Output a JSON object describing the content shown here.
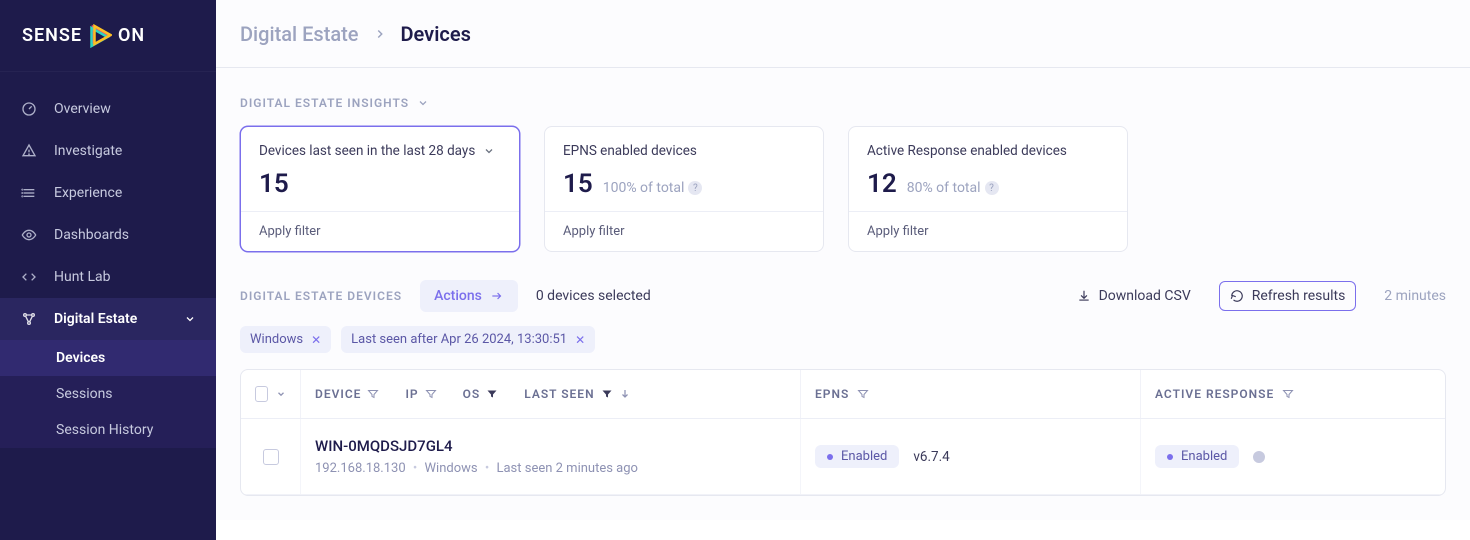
{
  "brand": {
    "text_left": "SENSE",
    "text_right": "ON"
  },
  "sidebar": {
    "items": [
      {
        "label": "Overview"
      },
      {
        "label": "Investigate"
      },
      {
        "label": "Experience"
      },
      {
        "label": "Dashboards"
      },
      {
        "label": "Hunt Lab"
      },
      {
        "label": "Digital Estate"
      }
    ],
    "sub": [
      {
        "label": "Devices"
      },
      {
        "label": "Sessions"
      },
      {
        "label": "Session History"
      }
    ]
  },
  "breadcrumb": {
    "parent": "Digital Estate",
    "current": "Devices"
  },
  "insights": {
    "heading": "DIGITAL ESTATE INSIGHTS",
    "cards": [
      {
        "title": "Devices last seen in the last 28 days",
        "value": "15",
        "sub": "",
        "footer": "Apply filter"
      },
      {
        "title": "EPNS enabled devices",
        "value": "15",
        "sub": "100% of total",
        "footer": "Apply filter"
      },
      {
        "title": "Active Response enabled devices",
        "value": "12",
        "sub": "80% of total",
        "footer": "Apply filter"
      }
    ]
  },
  "devices": {
    "heading": "DIGITAL ESTATE DEVICES",
    "actions_label": "Actions",
    "selected_text": "0 devices selected",
    "download_label": "Download CSV",
    "refresh_label": "Refresh results",
    "refreshed_ago": "2 minutes",
    "chips": [
      "Windows",
      "Last seen after Apr 26 2024, 13:30:51"
    ],
    "columns": {
      "device": "DEVICE",
      "ip": "IP",
      "os": "OS",
      "last_seen": "LAST SEEN",
      "epns": "EPNS",
      "active_response": "ACTIVE RESPONSE"
    },
    "rows": [
      {
        "name": "WIN-0MQDSJD7GL4",
        "ip": "192.168.18.130",
        "os": "Windows",
        "last_seen": "Last seen 2 minutes ago",
        "epns_status": "Enabled",
        "epns_version": "v6.7.4",
        "ar_status": "Enabled"
      }
    ]
  }
}
